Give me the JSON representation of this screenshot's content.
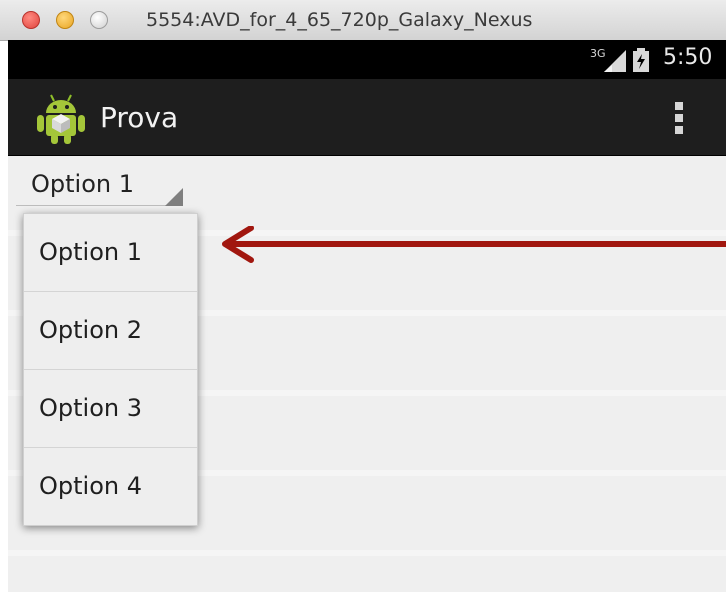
{
  "window": {
    "title": "5554:AVD_for_4_65_720p_Galaxy_Nexus"
  },
  "statusbar": {
    "time": "5:50",
    "network_label": "3G",
    "signal_icon": "signal-icon",
    "battery_icon": "battery-charging-icon"
  },
  "actionbar": {
    "title": "Prova",
    "app_icon": "android-robot-icon",
    "overflow_icon": "overflow-menu-icon"
  },
  "spinner": {
    "selected": "Option 1",
    "options": [
      "Option 1",
      "Option 2",
      "Option 3",
      "Option 4"
    ]
  },
  "annotation": {
    "arrow_color": "#a1170f"
  },
  "colors": {
    "actionbar_bg": "#1e1e1e",
    "statusbar_bg": "#000000",
    "content_bg": "#efefef"
  }
}
